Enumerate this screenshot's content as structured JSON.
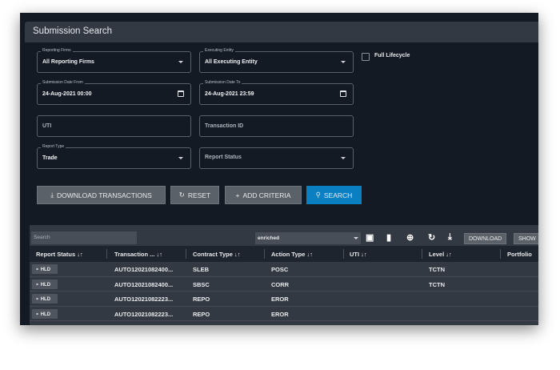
{
  "header": {
    "title": "Submission Search"
  },
  "form": {
    "reporting_firms": {
      "label": "Reporting Firms",
      "value": "All Reporting Firms"
    },
    "executing_entity": {
      "label": "Executing Entity",
      "value": "All Executing Entity"
    },
    "full_lifecycle": {
      "label": "Full Lifecycle",
      "checked": false
    },
    "date_from": {
      "label": "Submission Date From",
      "value": "24-Aug-2021 00:00"
    },
    "date_to": {
      "label": "Submission Date To",
      "value": "24-Aug-2021 23:59"
    },
    "uti": {
      "placeholder": "UTI"
    },
    "transaction_id": {
      "placeholder": "Transaction ID"
    },
    "report_type": {
      "label": "Report Type",
      "value": "Trade"
    },
    "report_status": {
      "placeholder": "Report Status"
    }
  },
  "buttons": {
    "download": "DOWNLOAD TRANSACTIONS",
    "reset": "RESET",
    "add": "ADD CRITERIA",
    "search": "SEARCH"
  },
  "colors": {
    "accent": "#0a7fc1"
  },
  "table": {
    "search_placeholder": "Search",
    "view": "enriched",
    "download": "DOWNLOAD",
    "show": "SHOW",
    "columns": [
      "Report Status",
      "Transaction ...",
      "Contract Type",
      "Action Type",
      "UTI",
      "Level",
      "Portfolio"
    ],
    "rows": [
      {
        "status": "HLD",
        "txn": "AUTO12021082400...",
        "contract": "SLEB",
        "action": "POSC",
        "uti": "",
        "level": "TCTN"
      },
      {
        "status": "HLD",
        "txn": "AUTO12021082400...",
        "contract": "SBSC",
        "action": "CORR",
        "uti": "",
        "level": "TCTN"
      },
      {
        "status": "HLD",
        "txn": "AUTO12021082223...",
        "contract": "REPO",
        "action": "EROR",
        "uti": "",
        "level": ""
      },
      {
        "status": "HLD",
        "txn": "AUTO12021082223...",
        "contract": "REPO",
        "action": "EROR",
        "uti": "",
        "level": ""
      }
    ]
  }
}
